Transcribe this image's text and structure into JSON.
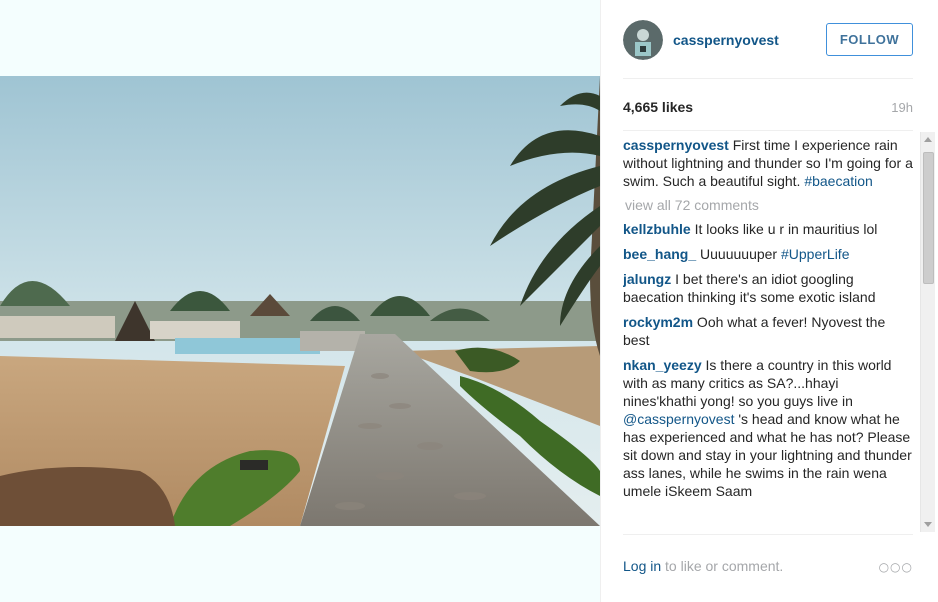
{
  "post": {
    "username": "casspernyovest",
    "follow_label": "FOLLOW",
    "likes": "4,665 likes",
    "time": "19h"
  },
  "caption": {
    "user": "casspernyovest",
    "text": " First time I experience rain without lightning and thunder so I'm going for a swim. Such a beautiful sight. ",
    "hashtag": "#baecation"
  },
  "view_all": "view all 72 comments",
  "comments": [
    {
      "user": "kellzbuhle",
      "text": " It looks like u r in mauritius lol"
    },
    {
      "user": "bee_hang_",
      "text": " Uuuuuuuper ",
      "tag": "#UpperLife"
    },
    {
      "user": "jalungz",
      "text": " I bet there's an idiot googling baecation thinking it's some exotic island"
    },
    {
      "user": "rockym2m",
      "text": " Ooh what a fever! Nyovest the best"
    },
    {
      "user": "nkan_yeezy",
      "text": " Is there a country in this world with as many critics as SA?...hhayi nines'khathi yong! so you guys live in ",
      "tag": "@casspernyovest",
      "text2": " 's head and know what he has experienced and what he has not? Please sit down and stay in your lightning and thunder ass lanes, while he swims in the rain wena umele iSkeem Saam"
    }
  ],
  "footer": {
    "login_label": "Log in",
    "suffix": " to like or comment.",
    "more_label": "○○○"
  },
  "icons": {
    "avatar": "profile-avatar-icon",
    "more": "more-options-icon"
  },
  "colors": {
    "username": "#125688",
    "follow_border": "#4090db",
    "muted": "#a5a7aa"
  }
}
